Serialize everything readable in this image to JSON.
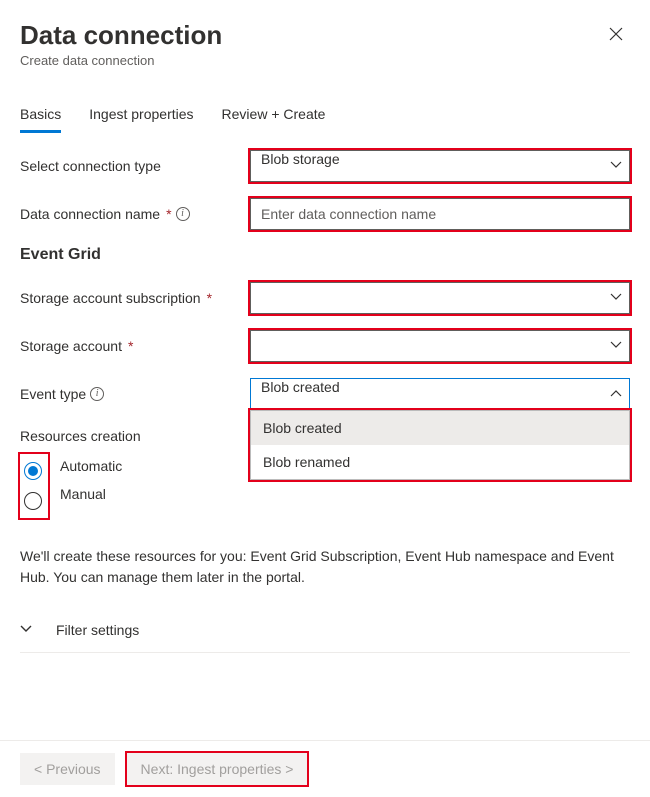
{
  "header": {
    "title": "Data connection",
    "subtitle": "Create data connection"
  },
  "tabs": [
    "Basics",
    "Ingest properties",
    "Review + Create"
  ],
  "active_tab": 0,
  "fields": {
    "connection_type": {
      "label": "Select connection type",
      "value": "Blob storage"
    },
    "connection_name": {
      "label": "Data connection name",
      "placeholder": "Enter data connection name",
      "value": ""
    },
    "section_event_grid": "Event Grid",
    "storage_subscription": {
      "label": "Storage account subscription",
      "value": ""
    },
    "storage_account": {
      "label": "Storage account",
      "value": ""
    },
    "event_type": {
      "label": "Event type",
      "value": "Blob created",
      "options": [
        "Blob created",
        "Blob renamed"
      ]
    },
    "resources_creation": {
      "label": "Resources creation",
      "options": [
        "Automatic",
        "Manual"
      ],
      "selected": 0
    }
  },
  "help_text": "We'll create these resources for you: Event Grid Subscription, Event Hub namespace and Event Hub. You can manage them later in the portal.",
  "expander": {
    "label": "Filter settings"
  },
  "footer": {
    "prev": "< Previous",
    "next": "Next: Ingest properties >"
  }
}
